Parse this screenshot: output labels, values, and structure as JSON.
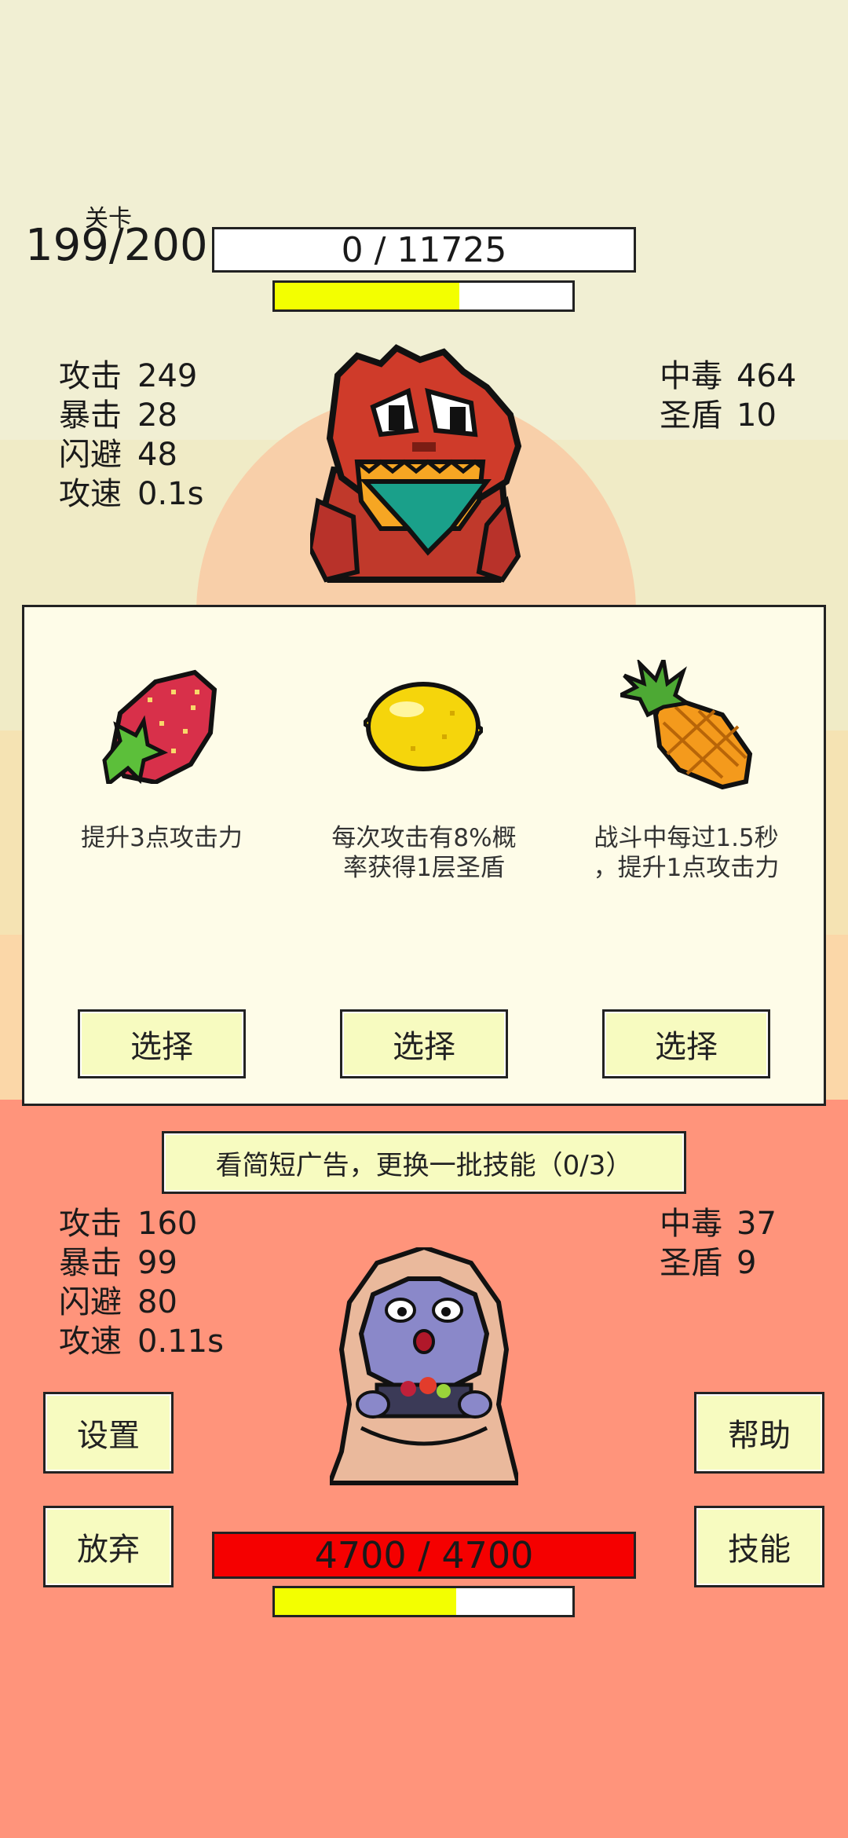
{
  "level": {
    "label": "关卡",
    "value": "199/200"
  },
  "enemy": {
    "hp_text": "0 / 11725",
    "cooldown_fraction": 0.62,
    "stats_left": [
      {
        "key": "攻击",
        "value": "249"
      },
      {
        "key": "暴击",
        "value": "28"
      },
      {
        "key": "闪避",
        "value": "48"
      },
      {
        "key": "攻速",
        "value": "0.1s"
      }
    ],
    "stats_right": [
      {
        "key": "中毒",
        "value": "464"
      },
      {
        "key": "圣盾",
        "value": "10"
      }
    ]
  },
  "choices": {
    "items": [
      {
        "icon": "strawberry-icon",
        "description_1": "提升3点攻击力",
        "description_2": "",
        "button": "选择"
      },
      {
        "icon": "lemon-icon",
        "description_1": "每次攻击有8%概",
        "description_2": "率获得1层圣盾",
        "button": "选择"
      },
      {
        "icon": "pineapple-icon",
        "description_1": "战斗中每过1.5秒",
        "description_2": "，提升1点攻击力",
        "button": "选择"
      }
    ],
    "ad_button": "看简短广告，更换一批技能（0/3）"
  },
  "player": {
    "hp_text": "4700 / 4700",
    "cooldown_fraction": 0.61,
    "stats_left": [
      {
        "key": "攻击",
        "value": "160"
      },
      {
        "key": "暴击",
        "value": "99"
      },
      {
        "key": "闪避",
        "value": "80"
      },
      {
        "key": "攻速",
        "value": "0.11s"
      }
    ],
    "stats_right": [
      {
        "key": "中毒",
        "value": "37"
      },
      {
        "key": "圣盾",
        "value": "9"
      }
    ]
  },
  "buttons": {
    "settings": "设置",
    "help": "帮助",
    "give_up": "放弃",
    "skills": "技能"
  },
  "colors": {
    "top_bg": "#f1efd3",
    "mid_bg": "#f6e4b8",
    "bottom_bg": "#ff937a",
    "panel_bg": "#fefce8",
    "button_bg": "#f7fbc0",
    "hp_red": "#f50000",
    "cooldown_yellow": "#f3ff00"
  }
}
